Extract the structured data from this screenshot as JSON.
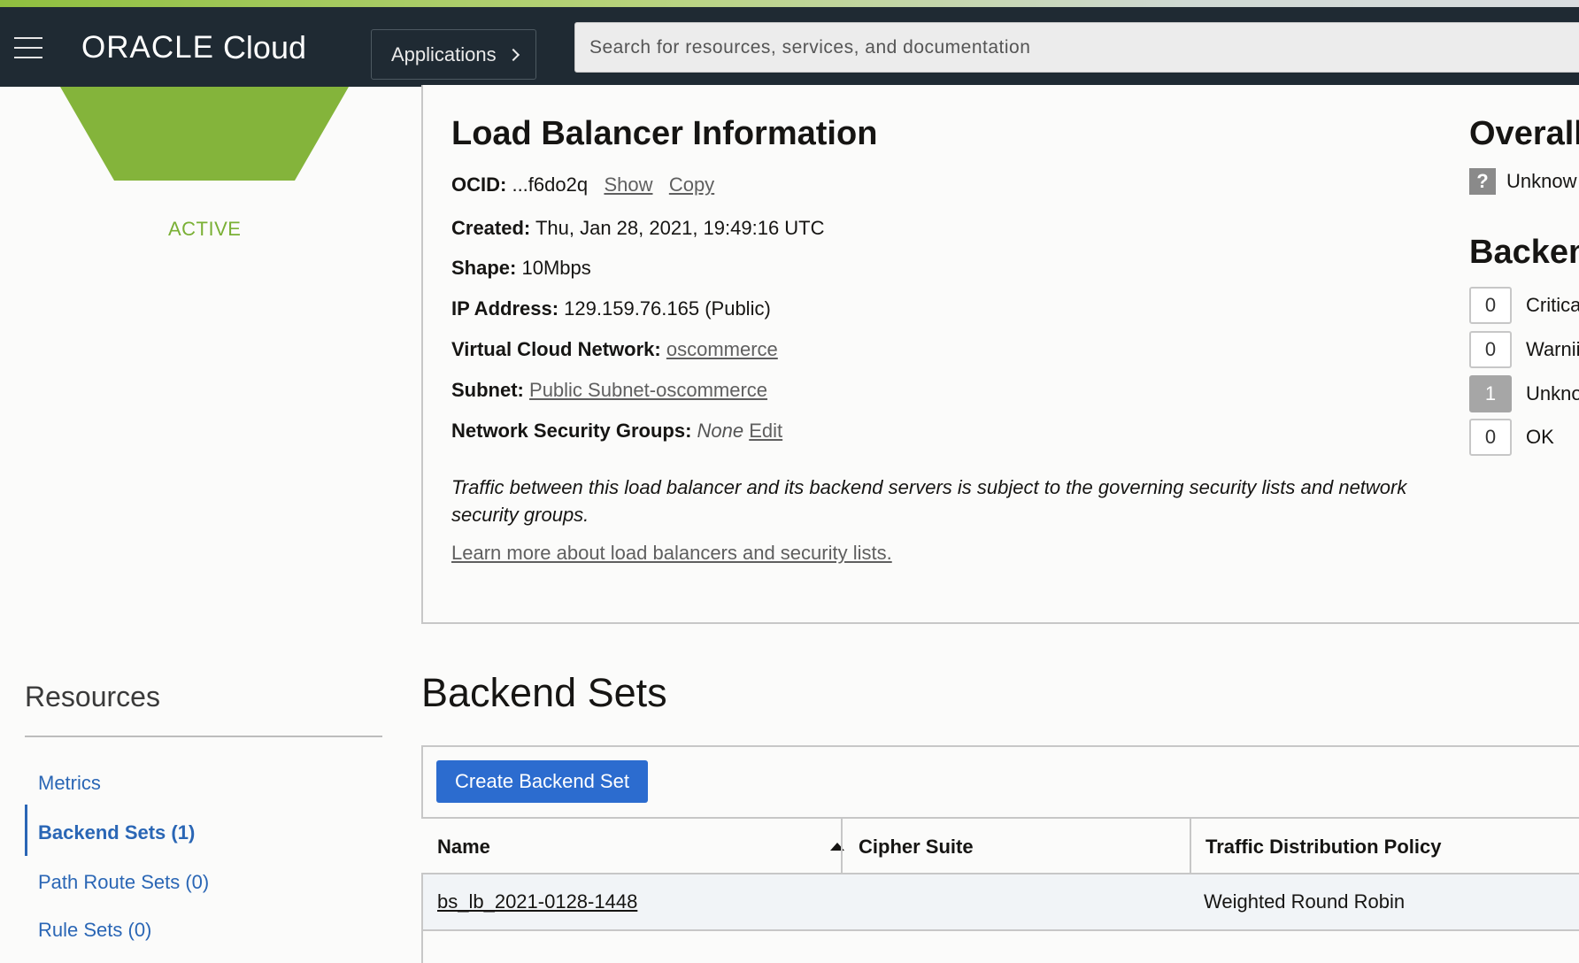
{
  "header": {
    "brand": "ORACLE",
    "product": "Cloud",
    "apps_label": "Applications",
    "search_placeholder": "Search for resources, services, and documentation"
  },
  "status": {
    "state": "ACTIVE",
    "color": "#7ab035"
  },
  "info": {
    "title": "Load Balancer Information",
    "ocid_label": "OCID:",
    "ocid_value": "...f6do2q",
    "show_link": "Show",
    "copy_link": "Copy",
    "created_label": "Created:",
    "created_value": "Thu, Jan 28, 2021, 19:49:16 UTC",
    "shape_label": "Shape:",
    "shape_value": "10Mbps",
    "ip_label": "IP Address:",
    "ip_value": "129.159.76.165 (Public)",
    "vcn_label": "Virtual Cloud Network:",
    "vcn_value": "oscommerce",
    "subnet_label": "Subnet:",
    "subnet_value": "Public Subnet-oscommerce",
    "nsg_label": "Network Security Groups:",
    "nsg_value": "None",
    "nsg_edit": "Edit",
    "traffic_note": "Traffic between this load balancer and its backend servers is subject to the governing security lists and network security groups.",
    "learn_more": "Learn more about load balancers and security lists."
  },
  "overall": {
    "title": "Overall",
    "status_icon": "?",
    "status_text": "Unknow"
  },
  "backend_health": {
    "title": "Backen",
    "rows": [
      {
        "count": "0",
        "label": "Critica"
      },
      {
        "count": "0",
        "label": "Warnii"
      },
      {
        "count": "1",
        "label": "Unkno"
      },
      {
        "count": "0",
        "label": "OK"
      }
    ]
  },
  "resources": {
    "title": "Resources",
    "items": [
      {
        "label": "Metrics"
      },
      {
        "label": "Backend Sets (1)"
      },
      {
        "label": "Path Route Sets (0)"
      },
      {
        "label": "Rule Sets (0)"
      }
    ]
  },
  "backend_sets": {
    "title": "Backend Sets",
    "create_button": "Create Backend Set",
    "columns": [
      "Name",
      "Cipher Suite",
      "Traffic Distribution Policy"
    ],
    "rows": [
      {
        "name": "bs_lb_2021-0128-1448",
        "cipher": "",
        "policy": "Weighted Round Robin"
      }
    ]
  }
}
